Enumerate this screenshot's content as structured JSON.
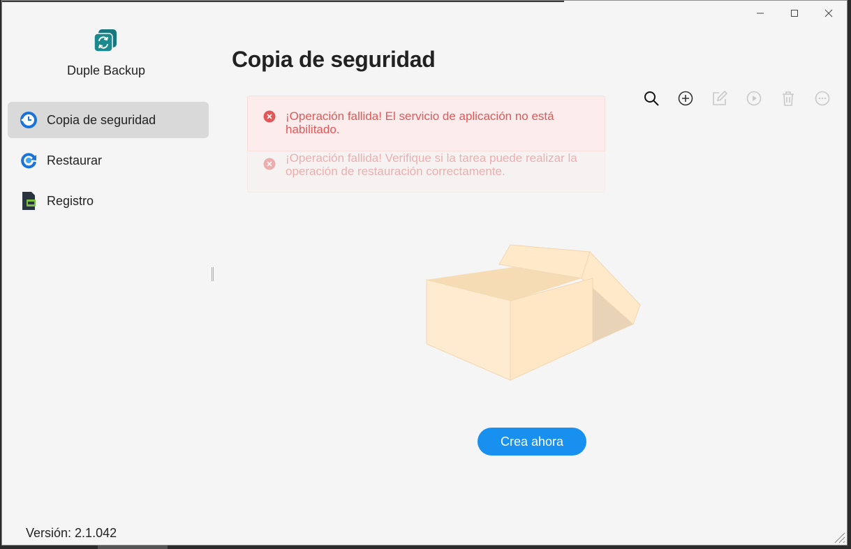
{
  "app": {
    "name": "Duple Backup",
    "version_label": "Versión: 2.1.042"
  },
  "window_controls": {
    "minimize_icon": "minimize-icon",
    "maximize_icon": "maximize-icon",
    "close_icon": "close-icon"
  },
  "sidebar": {
    "items": [
      {
        "label": "Copia de seguridad",
        "icon": "clock-icon",
        "active": true
      },
      {
        "label": "Restaurar",
        "icon": "refresh-icon",
        "active": false
      },
      {
        "label": "Registro",
        "icon": "log-icon",
        "active": false
      }
    ]
  },
  "main": {
    "title": "Copia de seguridad",
    "toolbar": [
      "search-icon",
      "add-icon",
      "edit-icon",
      "play-icon",
      "trash-icon",
      "more-icon"
    ],
    "alerts": [
      {
        "text": "¡Operación fallida! El servicio de aplicación no está habilitado."
      },
      {
        "text": "¡Operación fallida! Verifique si la tarea puede realizar la operación de restauración correctamente."
      }
    ],
    "empty_state_icon": "empty-box-icon",
    "create_button_label": "Crea ahora"
  },
  "colors": {
    "accent": "#1890f0",
    "error": "#e25858",
    "logo": "#1b8a8f"
  }
}
